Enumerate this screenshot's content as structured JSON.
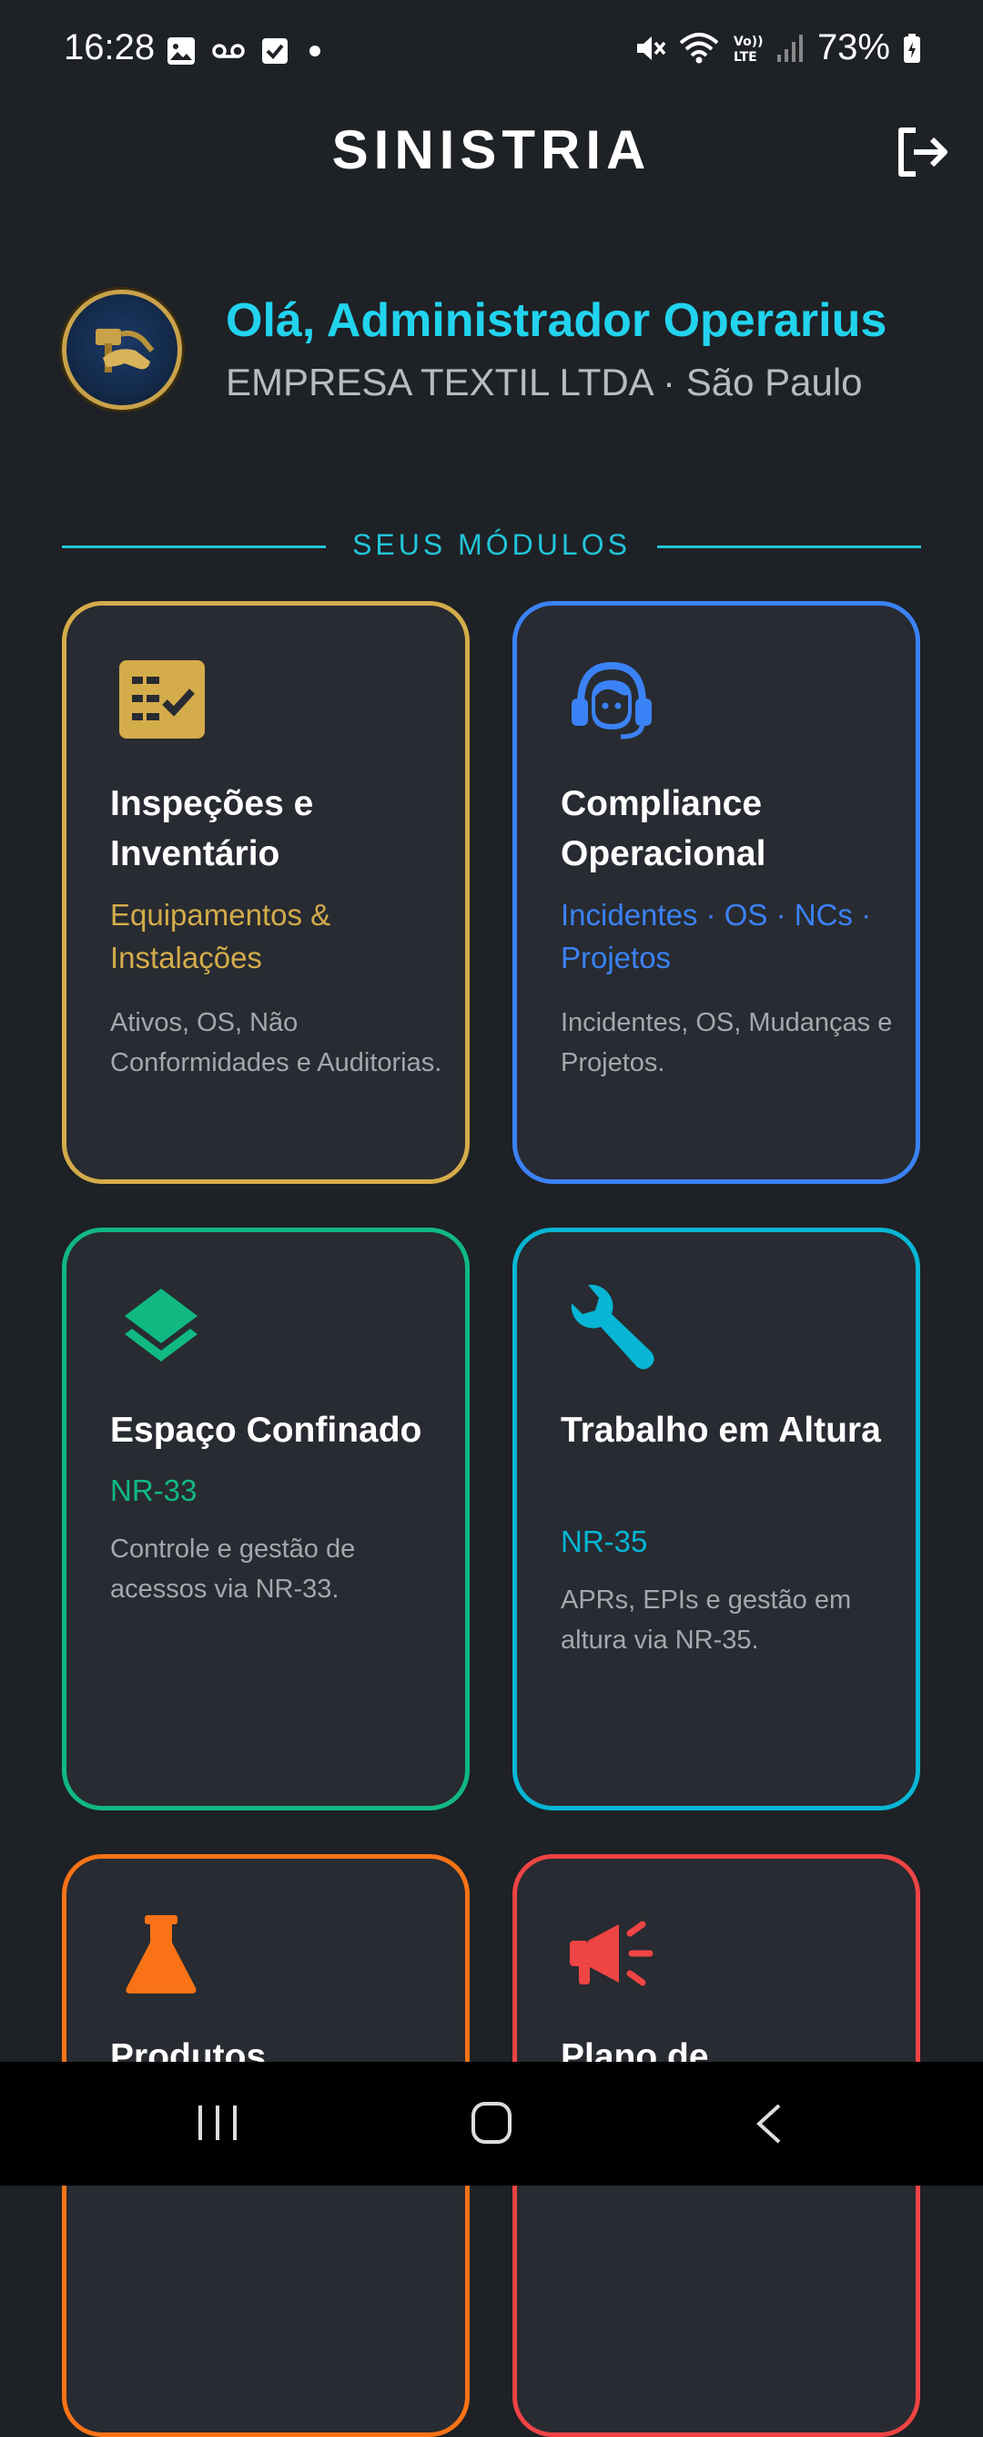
{
  "status_bar": {
    "time": "16:28",
    "battery": "73%"
  },
  "header": {
    "title": "SINISTRIA"
  },
  "greeting": {
    "hello": "Olá, Administrador Operarius",
    "company": "EMPRESA TEXTIL LTDA · São Paulo"
  },
  "section": {
    "title": "SEUS MÓDULOS"
  },
  "modules": [
    {
      "title": "Inspeções e Inventário",
      "subtitle": "Equipamentos & Instalações",
      "description": "Ativos, OS, Não Conformidades e Auditorias.",
      "icon": "checklist-icon",
      "color": "#d4ac4a"
    },
    {
      "title": "Compliance Operacional",
      "subtitle": "Incidentes · OS · NCs · Projetos",
      "description": "Incidentes, OS, Mudanças e Projetos.",
      "icon": "headset-icon",
      "color": "#3b82f6"
    },
    {
      "title": "Espaço Confinado",
      "subtitle": "NR-33",
      "description": "Controle e gestão de acessos via NR-33.",
      "icon": "layers-icon",
      "color": "#10b981"
    },
    {
      "title": "Trabalho em Altura",
      "subtitle": "NR-35",
      "description": "APRs, EPIs e gestão em altura via NR-35.",
      "icon": "wrench-icon",
      "color": "#06b6d4"
    },
    {
      "title": "Produtos",
      "subtitle": "",
      "description": "",
      "icon": "flask-icon",
      "color": "#f97316"
    },
    {
      "title": "Plano de",
      "subtitle": "",
      "description": "",
      "icon": "megaphone-icon",
      "color": "#ef4444"
    }
  ]
}
